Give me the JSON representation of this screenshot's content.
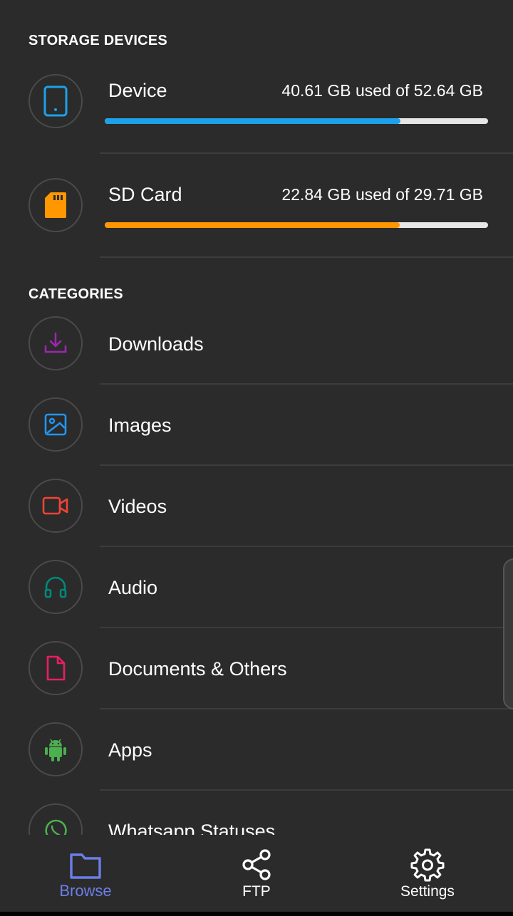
{
  "storage_header": "STORAGE DEVICES",
  "storage": [
    {
      "name": "Device",
      "usage": "40.61 GB used of 52.64 GB",
      "used_fraction": 0.772,
      "color": "#1da1e8",
      "icon": "phone-icon"
    },
    {
      "name": "SD Card",
      "usage": "22.84 GB used of 29.71 GB",
      "used_fraction": 0.769,
      "color": "#ff9800",
      "icon": "sd-card-icon"
    }
  ],
  "categories_header": "CATEGORIES",
  "categories": [
    {
      "label": "Downloads",
      "icon": "download-icon",
      "color": "#9c27b0"
    },
    {
      "label": "Images",
      "icon": "image-icon",
      "color": "#2196f3"
    },
    {
      "label": "Videos",
      "icon": "video-icon",
      "color": "#f44336"
    },
    {
      "label": "Audio",
      "icon": "headphones-icon",
      "color": "#00897b"
    },
    {
      "label": "Documents & Others",
      "icon": "document-icon",
      "color": "#e91e63"
    },
    {
      "label": "Apps",
      "icon": "android-icon",
      "color": "#4caf50"
    },
    {
      "label": "Whatsapp Statuses",
      "icon": "whatsapp-icon",
      "color": "#4caf50"
    }
  ],
  "nav": {
    "browse": "Browse",
    "ftp": "FTP",
    "settings": "Settings",
    "active_color": "#6b7fe8"
  }
}
